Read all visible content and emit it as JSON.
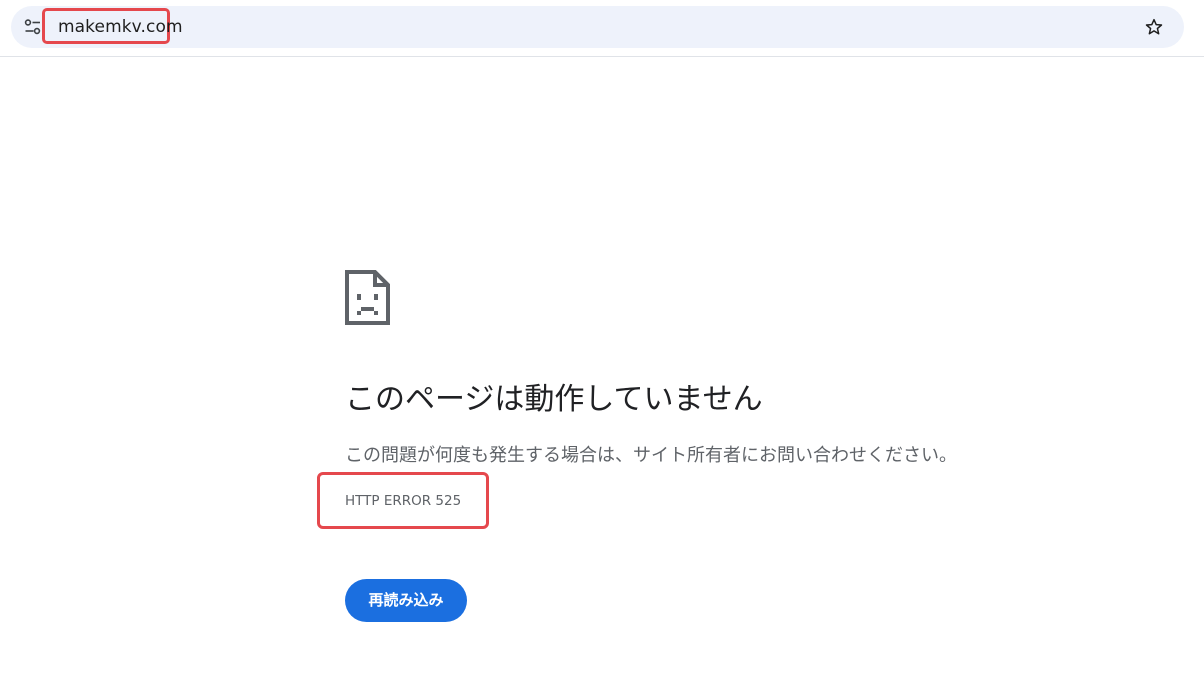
{
  "address_bar": {
    "url": "makemkv.com",
    "site_info_icon": "tune-icon",
    "bookmark_icon": "star-outline-icon"
  },
  "error_page": {
    "icon": "sad-page-icon",
    "headline": "このページは動作していません",
    "description": "この問題が何度も発生する場合は、サイト所有者にお問い合わせください。",
    "error_code": "HTTP ERROR 525",
    "reload_label": "再読み込み"
  },
  "colors": {
    "omnibox_bg": "#eef2fb",
    "highlight_border": "#e5484d",
    "button_bg": "#1b6fe0",
    "headline_text": "#202124",
    "secondary_text": "#5f6368"
  }
}
